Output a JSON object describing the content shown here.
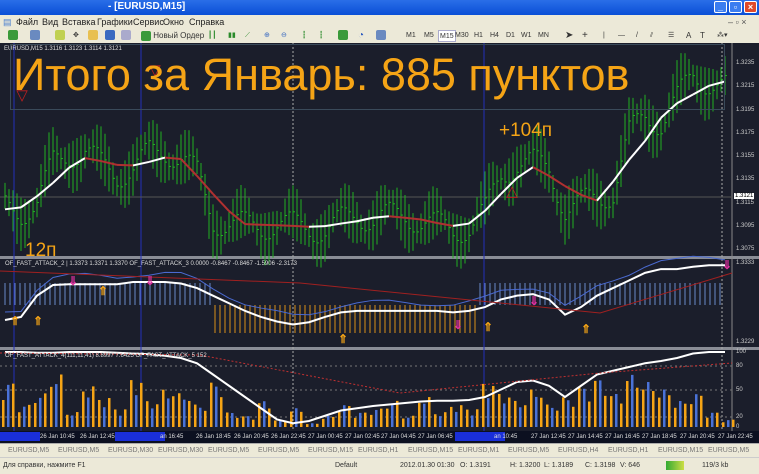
{
  "window": {
    "title": "- [EURUSD,M15]"
  },
  "menu": [
    "Файл",
    "Вид",
    "Вставка",
    "Графики",
    "Сервис",
    "Окно",
    "Справка"
  ],
  "toolbar": {
    "new_order": "Новый Ордер",
    "timeframes": [
      "M1",
      "M5",
      "M15",
      "M30",
      "H1",
      "H4",
      "D1",
      "W1",
      "MN"
    ],
    "active_timeframe": "M15"
  },
  "chart": {
    "symbol_header": "EURUSD,M15  1.3116 1.3123 1.3114 1.3121",
    "headline": "Итого за Январь: 885 пунктов",
    "annotations": {
      "left": "12п",
      "right": "+104п"
    },
    "current_price": "1.3121",
    "price_axis": [
      "1.3235",
      "1.3215",
      "1.3195",
      "1.3175",
      "1.3155",
      "1.3135",
      "1.3115",
      "1.3095",
      "1.3075"
    ],
    "indicator1_title": "OF_FAST_ATTACK_2 | 1.3373 1.3371 1.3370  OF_FAST_ATTACK_3 0.0000 -0.8467 -0.8467 -1.5906 -2.3173",
    "indicator1_axis": [
      "1.3333",
      "1.3229"
    ],
    "indicator2_title": "OF_FAST_ATTACK_4(111,11,41) 8.8997 7.6425  OF_FAST_ATTACK_5 152",
    "indicator2_axis": [
      "100",
      "80",
      "50",
      "20",
      "0"
    ],
    "time_axis": [
      "26 Jan 10:45",
      "26 Jan 12:45",
      "an 16:45",
      "26 Jan 18:45",
      "26 Jan 20:45",
      "26 Jan 22:45",
      "27 Jan 00:45",
      "27 Jan 02:45",
      "27 Jan 04:45",
      "27 Jan 06:45",
      "an 10:45",
      "27 Jan 12:45",
      "27 Jan 14:45",
      "27 Jan 16:45",
      "27 Jan 18:45",
      "27 Jan 20:45",
      "27 Jan 22:45"
    ]
  },
  "chart_data": {
    "type": "line",
    "title": "EURUSD,M15",
    "ylim": [
      1.3065,
      1.3245
    ],
    "close": [
      1.3112,
      1.3108,
      1.3115,
      1.315,
      1.3158,
      1.316,
      1.3148,
      1.314,
      1.3145,
      1.3158,
      1.316,
      1.3155,
      1.314,
      1.31,
      1.3098,
      1.3096,
      1.3095,
      1.3098,
      1.3096,
      1.3094,
      1.3092,
      1.31,
      1.3105,
      1.3102,
      1.3104,
      1.3105,
      1.31,
      1.3096,
      1.3092,
      1.3095,
      1.3108,
      1.314,
      1.315,
      1.315,
      1.3145,
      1.311,
      1.3115,
      1.312,
      1.3125,
      1.3175,
      1.319,
      1.3185,
      1.3205,
      1.3225,
      1.322,
      1.3215
    ],
    "indicator1_line": [
      1.3258,
      1.3262,
      1.329,
      1.3304,
      1.3305,
      1.3305,
      1.3305,
      1.3305,
      1.3308,
      1.3308,
      1.3308,
      1.3306,
      1.33,
      1.329,
      1.328,
      1.327,
      1.3262,
      1.3256,
      1.3252,
      1.3255,
      1.3262,
      1.3268,
      1.327,
      1.327,
      1.327,
      1.327,
      1.327,
      1.327,
      1.3268,
      1.327,
      1.3275,
      1.3285,
      1.329,
      1.3292,
      1.3285,
      1.3265,
      1.3275,
      1.329,
      1.33,
      1.331,
      1.332,
      1.3325,
      1.3325,
      1.3328,
      1.333,
      1.333
    ],
    "indicator2_line": [
      100,
      100,
      99,
      99,
      100,
      100,
      100,
      99,
      98,
      97,
      95,
      92,
      85,
      70,
      55,
      40,
      25,
      10,
      5,
      8,
      15,
      22,
      25,
      28,
      30,
      32,
      34,
      35,
      35,
      36,
      40,
      50,
      60,
      62,
      55,
      40,
      55,
      70,
      75,
      80,
      85,
      88,
      92,
      98,
      100,
      100
    ],
    "indicator2_hist": [
      60,
      30,
      45,
      70,
      20,
      55,
      40,
      25,
      65,
      35,
      50,
      45,
      30,
      60,
      20,
      15,
      35,
      10,
      25,
      5,
      15,
      30,
      20,
      25,
      35,
      15,
      40,
      20,
      30,
      25,
      60,
      45,
      35,
      50,
      30,
      40,
      55,
      65,
      45,
      70,
      60,
      50,
      35,
      45,
      20,
      10
    ]
  },
  "tabs": [
    "EURUSD,M5",
    "EURUSD,M5",
    "EURUSD,M30",
    "EURUSD,M30",
    "EURUSD,M5",
    "EURUSD,M5",
    "EURUSD,M15",
    "EURUSD,H1",
    "EURUSD,M15",
    "EURUSD,M1",
    "EURUSD,M5",
    "EURUSD,H4",
    "EURUSD,H1",
    "EURUSD,M15",
    "EURUSD,M5"
  ],
  "status": {
    "help": "Для справки, нажмите F1",
    "profile": "Default",
    "datetime": "2012.01.30 01:30",
    "open": "O: 1.3191",
    "high": "H: 1.3200",
    "low": "L: 1.3189",
    "close": "C: 1.3198",
    "volume": "V: 646",
    "traffic": "119/3 kb"
  },
  "colors": {
    "bars": "#22b022",
    "ma_up": "#ffffff",
    "ma_down": "#b03030",
    "headline": "#f5a416",
    "hist_a": "#f5a416",
    "hist_b": "#4a72d8"
  }
}
